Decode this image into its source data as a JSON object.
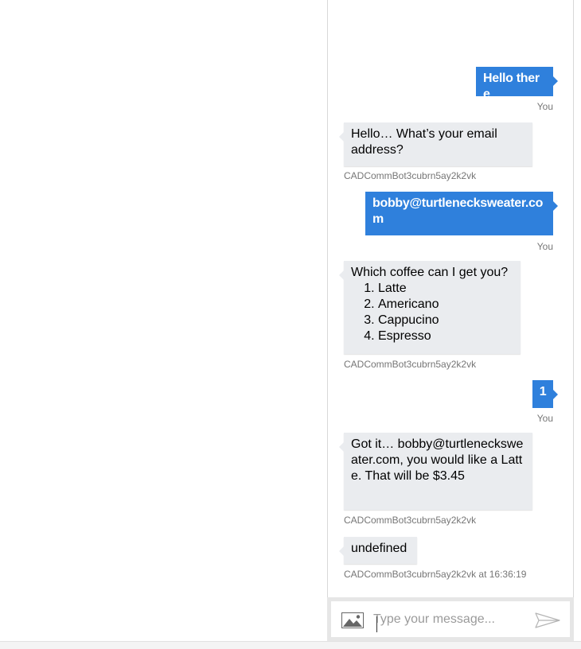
{
  "chat": {
    "messages": [
      {
        "from": "user",
        "text": "Hello there",
        "sender": "You"
      },
      {
        "from": "bot",
        "text": "Hello… What’s your email address?",
        "sender": "CADCommBot3cubrn5ay2k2vk"
      },
      {
        "from": "user",
        "text": "bobby@turtlenecksweater.com",
        "sender": "You"
      },
      {
        "from": "bot",
        "intro": "Which coffee can I get you?",
        "options": [
          "Latte",
          "Americano",
          "Cappucino",
          "Espresso"
        ],
        "sender": "CADCommBot3cubrn5ay2k2vk"
      },
      {
        "from": "user",
        "text": "1",
        "sender": "You"
      },
      {
        "from": "bot",
        "text": "Got it… bobby@turtlenecksweater.com, you would like a Latte. That will be $3.45",
        "sender": "CADCommBot3cubrn5ay2k2vk"
      },
      {
        "from": "bot",
        "text": "undefined",
        "sender": "CADCommBot3cubrn5ay2k2vk at 16:36:19"
      }
    ]
  },
  "input": {
    "placeholder": "Type your message...",
    "value": ""
  },
  "icons": {
    "upload": "image-icon",
    "send": "send-icon"
  },
  "colors": {
    "user_bubble": "#2f80dc",
    "bot_bubble": "#eaecef",
    "sender_text": "#767676"
  }
}
